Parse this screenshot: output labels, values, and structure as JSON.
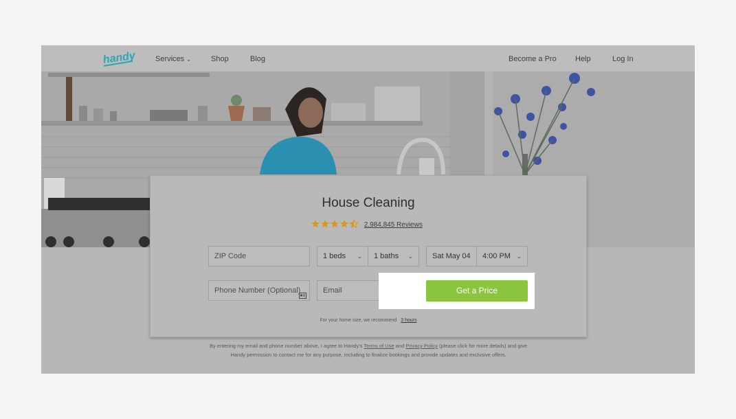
{
  "colors": {
    "accent_green": "#8bc540",
    "logo_teal": "#2aa6b5",
    "star_gold": "#d49a1d"
  },
  "header": {
    "logo_text": "handy",
    "nav_left": [
      {
        "label": "Services",
        "has_caret": true
      },
      {
        "label": "Shop"
      },
      {
        "label": "Blog"
      }
    ],
    "nav_right": [
      {
        "label": "Become a Pro"
      },
      {
        "label": "Help"
      },
      {
        "label": "Log In"
      }
    ]
  },
  "booking": {
    "title": "House Cleaning",
    "rating_stars": 4.5,
    "reviews_label": "2,984,845 Reviews",
    "zip_placeholder": "ZIP Code",
    "beds_value": "1 beds",
    "baths_value": "1 baths",
    "date_value": "Sat May 04",
    "time_value": "4:00 PM",
    "phone_placeholder": "Phone Number (Optional)",
    "email_placeholder": "Email",
    "cta_label": "Get a Price",
    "recommend_text": "For your home size, we recommend",
    "recommend_hours": "3 hours"
  },
  "legal": {
    "part1": "By entering my email and phone number above, I agree to Handy's",
    "terms_link": "Terms of Use",
    "and": "and",
    "privacy_link": "Privacy Policy",
    "part2": "(please click for more details) and give Handy permission to contact me for any purpose, including to finalize bookings and provide updates and exclusive offers."
  }
}
